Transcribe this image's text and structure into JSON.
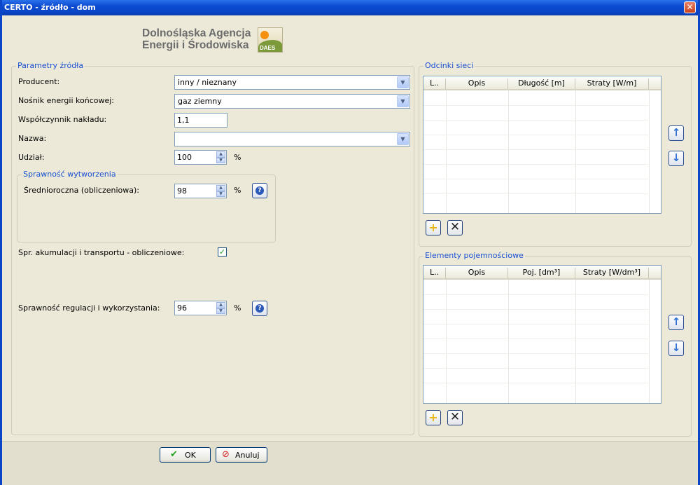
{
  "window": {
    "title": "CERTO - źródło - dom"
  },
  "logo": {
    "line1": "Dolnośląska Agencja",
    "line2": "Energii i Środowiska",
    "mark": "DAES"
  },
  "params": {
    "legend": "Parametry źródła",
    "producent_label": "Producent:",
    "producent_value": "inny / nieznany",
    "nosnik_label": "Nośnik energii końcowej:",
    "nosnik_value": "gaz ziemny",
    "wspolczynnik_label": "Współczynnik nakładu:",
    "wspolczynnik_value": "1,1",
    "nazwa_label": "Nazwa:",
    "nazwa_value": "",
    "udzial_label": "Udział:",
    "udzial_value": "100",
    "udzial_unit": "%"
  },
  "sprawnosc": {
    "legend": "Sprawność wytworzenia",
    "sr_label": "Średnioroczna (obliczeniowa):",
    "sr_value": "98",
    "sr_unit": "%"
  },
  "akumulacja": {
    "label": "Spr. akumulacji i transportu - obliczeniowe:",
    "checked": true,
    "mark": "✓"
  },
  "regulacja": {
    "label": "Sprawność regulacji i wykorzystania:",
    "value": "96",
    "unit": "%"
  },
  "odcinki": {
    "legend": "Odcinki sieci",
    "columns": [
      "L..",
      "Opis",
      "Długość [m]",
      "Straty [W/m]"
    ]
  },
  "elementy": {
    "legend": "Elementy pojemnościowe",
    "columns": [
      "L..",
      "Opis",
      "Poj. [dm³]",
      "Straty [W/dm³]"
    ]
  },
  "footer": {
    "ok_label": "OK",
    "cancel_label": "Anuluj"
  },
  "icons": {
    "close": "✕",
    "up": "↑",
    "down": "↓",
    "plus": "+",
    "cross": "✕",
    "ok": "✔",
    "cancel": "⊘",
    "help": "?"
  },
  "colors": {
    "titlebar": "#0b4bd1",
    "legend": "#1a4fd0",
    "accent_ok": "#21a121",
    "cancel": "#d42020"
  }
}
